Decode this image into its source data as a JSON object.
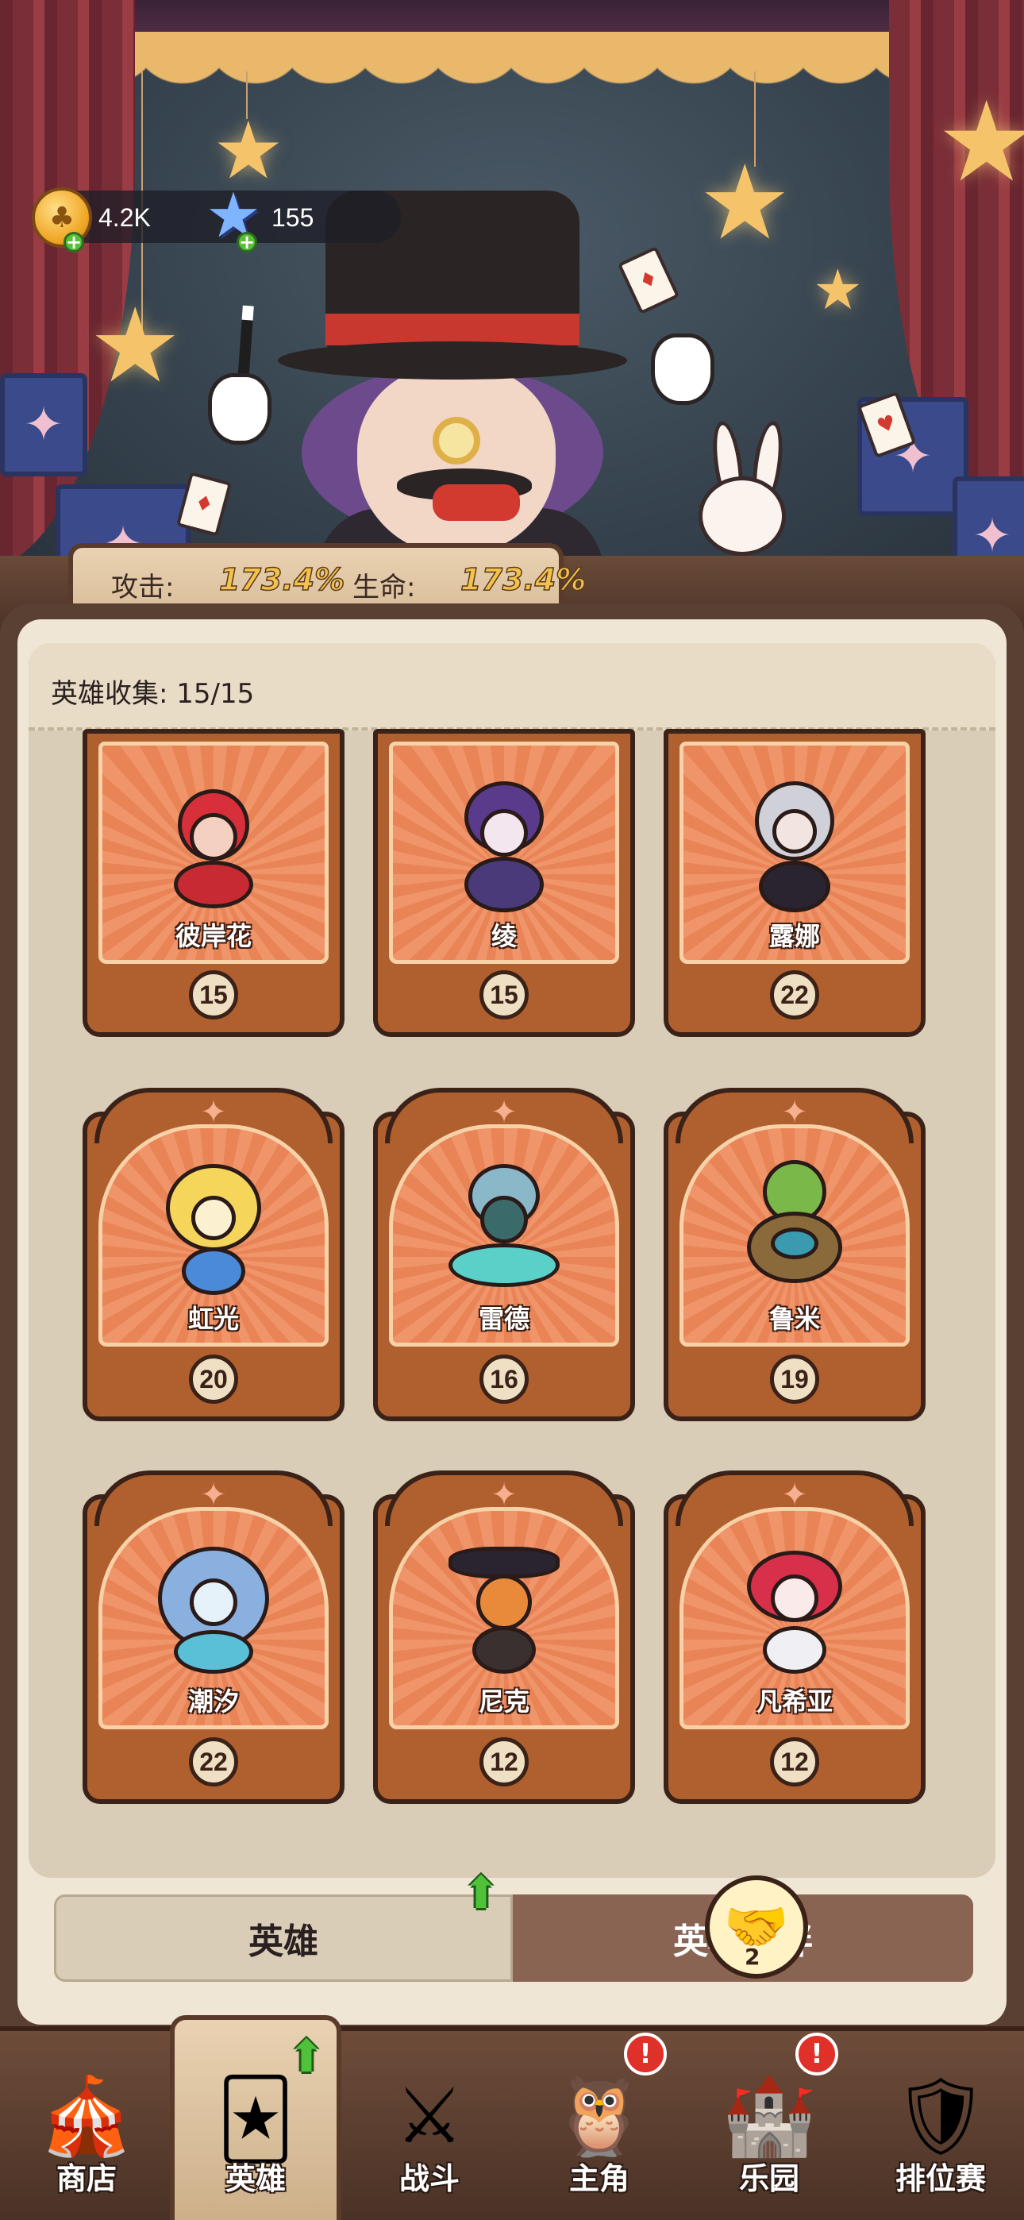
{
  "currency": {
    "gold": "4.2K",
    "gems": "155",
    "gold_icon": "clover-coin-icon",
    "gem_icon": "blue-star-icon"
  },
  "stats": {
    "attack_label": "攻击:",
    "attack_value": "173.4%",
    "hp_label": "生命:",
    "hp_value": "173.4%"
  },
  "collection": {
    "title": "英雄收集:  15/15"
  },
  "heroes": [
    {
      "name": "彼岸花",
      "level": "15"
    },
    {
      "name": "绫",
      "level": "15"
    },
    {
      "name": "露娜",
      "level": "22"
    },
    {
      "name": "虹光",
      "level": "20"
    },
    {
      "name": "雷德",
      "level": "16"
    },
    {
      "name": "鲁米",
      "level": "19"
    },
    {
      "name": "潮汐",
      "level": "22"
    },
    {
      "name": "尼克",
      "level": "12"
    },
    {
      "name": "凡希亚",
      "level": "12"
    }
  ],
  "tabs": {
    "heroes": "英雄",
    "bonds": "英雄羁绊",
    "bond_badge": "2"
  },
  "nav": {
    "shop": "商店",
    "heroes": "英雄",
    "battle": "战斗",
    "protagonist": "主角",
    "park": "乐园",
    "ranked": "排位赛",
    "alert": "!"
  },
  "colors": {
    "accent_gold": "#f3c24a",
    "card_brown": "#b0602e",
    "panel_bg": "#efe6d6"
  }
}
